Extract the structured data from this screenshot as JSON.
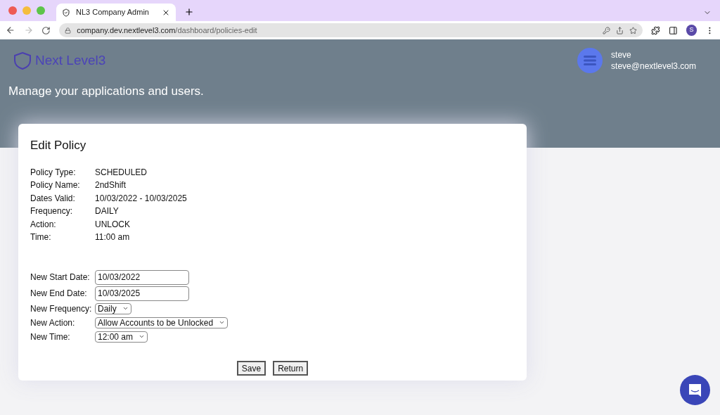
{
  "browser": {
    "tab_title": "NL3 Company Admin",
    "url_host": "company.dev.nextlevel3.com",
    "url_path": "/dashboard/policies-edit",
    "profile_initial": "S"
  },
  "header": {
    "logo_text": "Next Level3",
    "tagline": "Manage your applications and users.",
    "user_name": "steve",
    "user_email": "steve@nextlevel3.com"
  },
  "card": {
    "title": "Edit Policy",
    "details": [
      {
        "label": "Policy Type:",
        "value": "SCHEDULED"
      },
      {
        "label": "Policy Name:",
        "value": "2ndShift"
      },
      {
        "label": "Dates Valid:",
        "value": "10/03/2022 - 10/03/2025"
      },
      {
        "label": "Frequency:",
        "value": "DAILY"
      },
      {
        "label": "Action:",
        "value": "UNLOCK"
      },
      {
        "label": "Time:",
        "value": "11:00 am"
      }
    ],
    "fields": [
      {
        "kind": "text",
        "label": "New Start Date:",
        "value": "10/03/2022"
      },
      {
        "kind": "text",
        "label": "New End Date:",
        "value": "10/03/2025"
      },
      {
        "kind": "select",
        "label": "New Frequency:",
        "value": "Daily"
      },
      {
        "kind": "select",
        "label": "New Action:",
        "value": "Allow Accounts to be Unlocked"
      },
      {
        "kind": "select",
        "label": "New Time:",
        "value": "12:00 am"
      }
    ],
    "buttons": [
      "Save",
      "Return"
    ]
  }
}
